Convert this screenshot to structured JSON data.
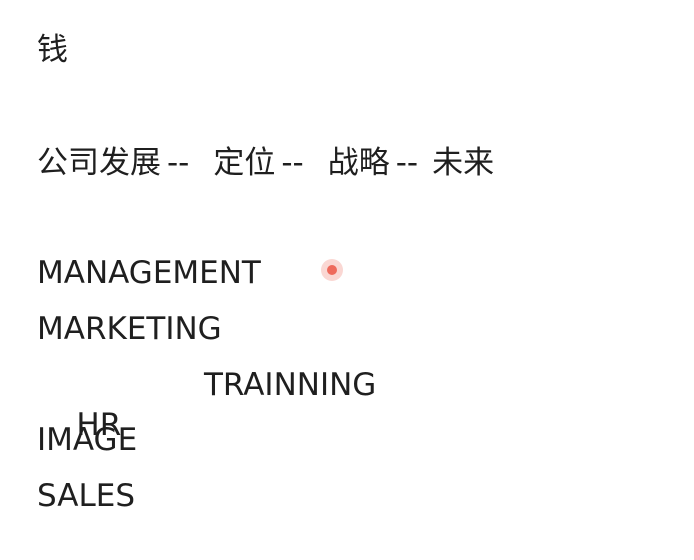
{
  "note": {
    "title": "钱",
    "path": {
      "seg1": "公司发展",
      "sep1": "--",
      "seg2": "定位",
      "sep2": "--",
      "seg3": "战略",
      "sep3": "--",
      "seg4": "未来"
    },
    "items": [
      {
        "label": "MANAGEMENT"
      },
      {
        "label": "MARKETING"
      },
      {
        "label": "HR",
        "extra": "TRAINNING"
      },
      {
        "label": "IMAGE"
      },
      {
        "label": "SALES"
      }
    ]
  },
  "colors": {
    "text": "#1f1f1f",
    "cursor": "#ee6a5c"
  }
}
